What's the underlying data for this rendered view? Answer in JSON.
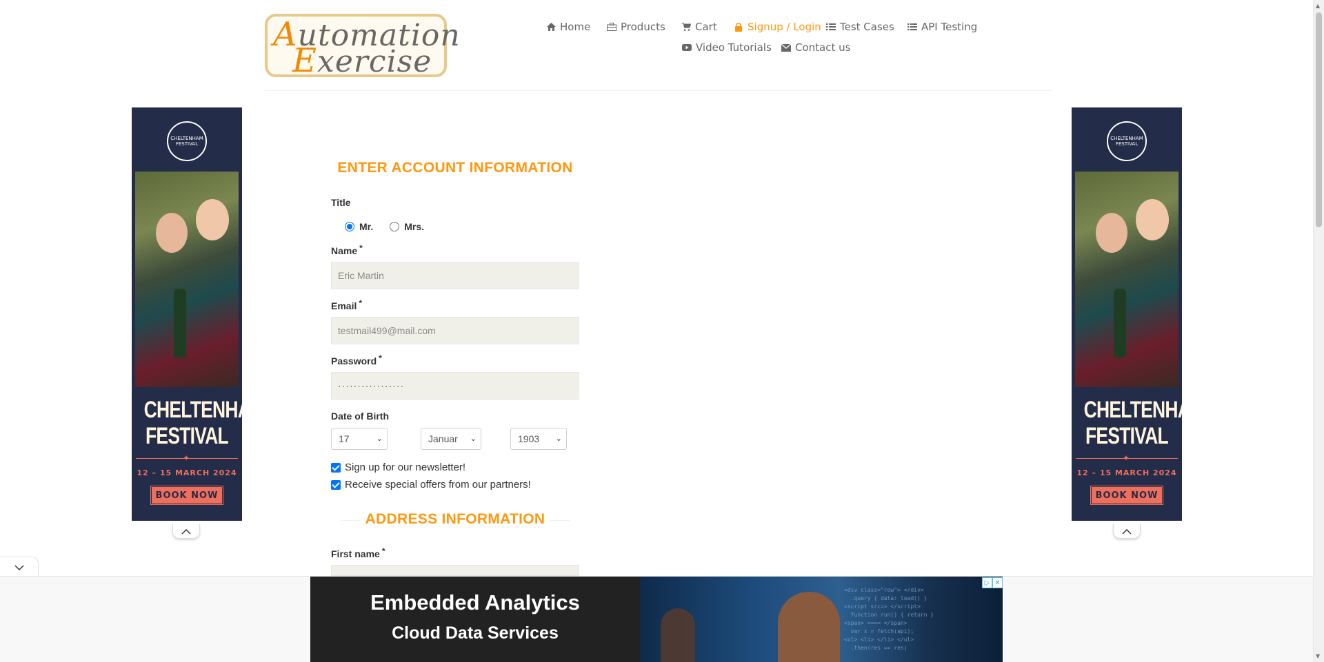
{
  "logo": {
    "line1_accent": "A",
    "line1_rest": "utomation",
    "line2_accent": "E",
    "line2_rest": "xercise"
  },
  "nav": [
    {
      "label": "Home",
      "icon": "home-icon"
    },
    {
      "label": "Products",
      "icon": "products-icon"
    },
    {
      "label": "Cart",
      "icon": "cart-icon"
    },
    {
      "label": "Signup / Login",
      "icon": "lock-icon",
      "active": true
    },
    {
      "label": "Test Cases",
      "icon": "list-icon"
    },
    {
      "label": "API Testing",
      "icon": "list-icon"
    },
    {
      "label": "Video Tutorials",
      "icon": "youtube-icon"
    },
    {
      "label": "Contact us",
      "icon": "envelope-icon"
    }
  ],
  "colors": {
    "accent": "#fe980f",
    "ad_navy": "#232c48",
    "ad_coral": "#ef6f5c"
  },
  "side_ad": {
    "crest": "CHELTENHAM FESTIVAL",
    "headline_1": "CHELTENHAM",
    "headline_2": "FESTIVAL",
    "dates": "12 – 15 MARCH 2024",
    "cta": "BOOK NOW"
  },
  "form": {
    "section_account": "ENTER ACCOUNT INFORMATION",
    "title_label": "Title",
    "title_options": [
      "Mr.",
      "Mrs."
    ],
    "title_selected": "Mr.",
    "name_label": "Name",
    "name_value": "Eric Martin",
    "email_label": "Email",
    "email_value": "testmail499@mail.com",
    "password_label": "Password",
    "password_value": "·················",
    "required_mark": "*",
    "dob_label": "Date of Birth",
    "dob_day": "17",
    "dob_month": "Januar",
    "dob_year": "1903",
    "newsletter_label": "Sign up for our newsletter!",
    "offers_label": "Receive special offers from our partners!",
    "section_address": "ADDRESS INFORMATION",
    "first_name_label": "First name"
  },
  "bottom_ad": {
    "headline": "Embedded Analytics",
    "subheadline": "Cloud Data Services",
    "choices_play": "▷",
    "choices_close": "✕"
  }
}
